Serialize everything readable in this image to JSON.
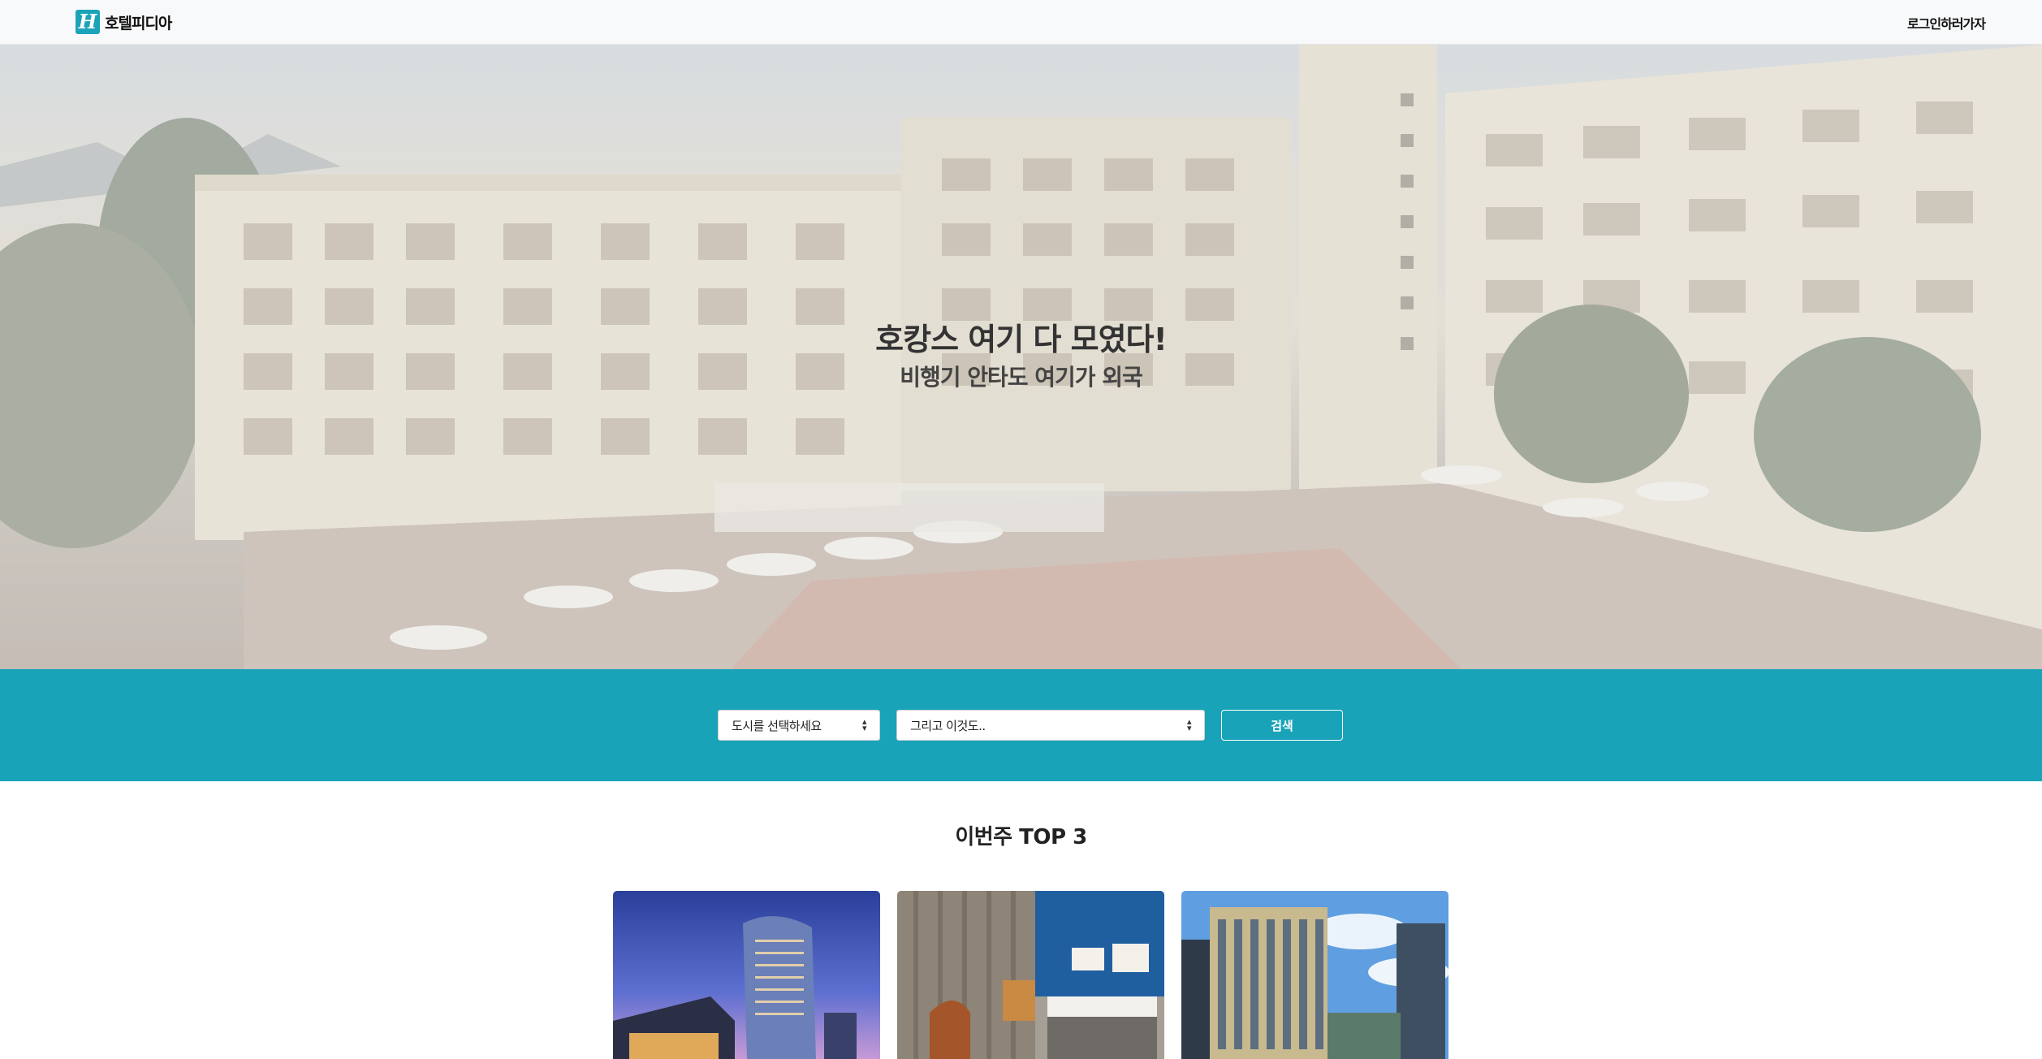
{
  "header": {
    "brand_logo_letter": "H",
    "brand_name": "호텔피디아",
    "login_link": "로그인하러가자"
  },
  "hero": {
    "title": "호캉스 여기 다 모였다!",
    "subtitle": "비행기 안타도 여기가 외국"
  },
  "search": {
    "city_select": "도시를 선택하세요",
    "extra_select": "그리고 이것도..",
    "button_label": "검색"
  },
  "top3": {
    "title": "이번주 TOP 3"
  },
  "colors": {
    "accent": "#19a3b8",
    "brand_logo": "#1ba3b8",
    "header_bg": "#f8f9fa"
  },
  "icons": {
    "brand": "hotel-h-logo-icon",
    "select_caret": "select-caret-icon"
  }
}
